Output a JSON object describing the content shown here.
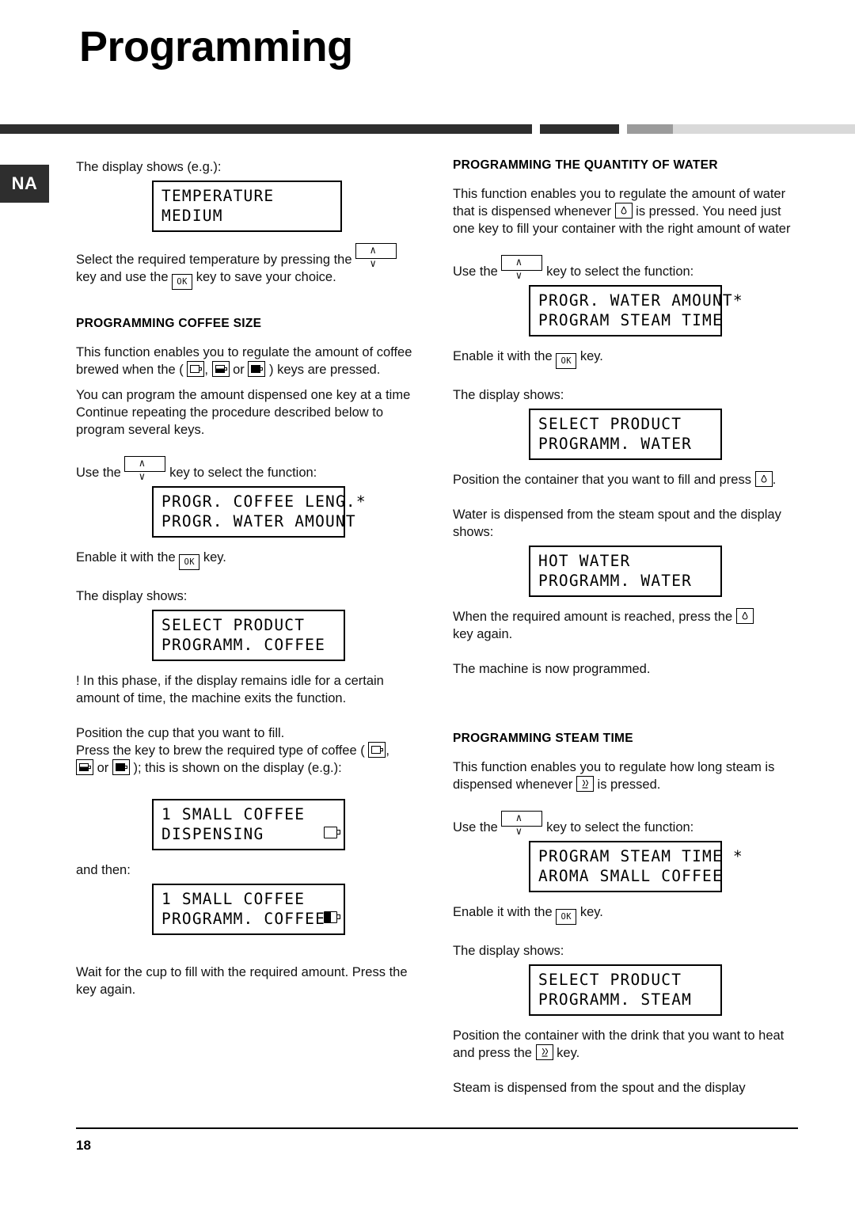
{
  "header": {
    "title": "Programming",
    "side_tab": "NA"
  },
  "footer": {
    "page_number": "18"
  },
  "left_column": {
    "intro_text": "The display shows (e.g.):",
    "lcd_temperature": {
      "line1": "TEMPERATURE",
      "line2": "MEDIUM"
    },
    "select_temp_part1": "Select the required temperature by pressing the",
    "select_temp_part2": "key and use the",
    "select_temp_part3": "key to save your choice.",
    "coffee_size_heading": "PROGRAMMING COFFEE SIZE",
    "coffee_size_p1_a": "This function enables you to regulate the amount of coffee brewed when the (",
    "coffee_size_p1_b": ",",
    "coffee_size_p1_c": "or",
    "coffee_size_p1_d": ") keys are pressed.",
    "coffee_size_p2": "You can program the amount dispensed one key at a time Continue repeating the procedure described below to program several keys.",
    "use_key_label": "Use the",
    "use_key_suffix": "key to select the function:",
    "lcd_progr_coffee": {
      "line1": "PROGR. COFFEE LENG.",
      "line1_mark": "*",
      "line2": "PROGR. WATER AMOUNT"
    },
    "enable_prefix": "Enable it with the",
    "enable_suffix": "key.",
    "display_shows": "The display shows:",
    "lcd_select_product_coffee": {
      "line1": "SELECT PRODUCT",
      "line2": "PROGRAMM. COFFEE"
    },
    "idle_warning": "! In this phase, if the display remains idle for a certain amount of time, the machine exits the function.",
    "position_cup": "Position the cup that you want to fill.",
    "press_key_a": "Press the key to brew the required type of coffee (",
    "press_key_b": ",",
    "press_key_c": "or",
    "press_key_d": "); this is shown on the display (e.g.):",
    "lcd_dispensing": {
      "line1": "1 SMALL COFFEE",
      "line2": "DISPENSING"
    },
    "and_then": "and then:",
    "lcd_programm_coffee": {
      "line1": "1 SMALL COFFEE",
      "line2": "PROGRAMM. COFFEE"
    },
    "wait_text": "Wait for the cup to fill with the required amount. Press the key again."
  },
  "right_column": {
    "water_heading": "PROGRAMMING THE QUANTITY OF WATER",
    "water_p1_a": "This function enables you to regulate the amount of water that is dispensed whenever",
    "water_p1_b": "is pressed. You need just one key to fill your container with the right amount of water",
    "use_key_label": "Use the",
    "use_key_suffix": "key to select the function:",
    "lcd_progr_water": {
      "line1": "PROGR. WATER AMOUNT",
      "line1_mark": "*",
      "line2": "PROGRAM STEAM TIME"
    },
    "enable_prefix": "Enable it with the",
    "enable_suffix": "key.",
    "display_shows": "The display shows:",
    "lcd_select_product_water": {
      "line1": "SELECT PRODUCT",
      "line2": "PROGRAMM. WATER"
    },
    "position_container_a": "Position the container that you want to fill and press",
    "position_container_b": ".",
    "water_dispensed": "Water is dispensed from the steam spout and the display shows:",
    "lcd_hot_water": {
      "line1": "HOT WATER",
      "line2": "PROGRAMM. WATER"
    },
    "when_reached_a": "When the required amount is reached, press the",
    "when_reached_b": "key again.",
    "machine_programmed": "The machine is now programmed.",
    "steam_heading": "PROGRAMMING STEAM TIME",
    "steam_p1_a": "This function enables you to regulate how long steam is dispensed whenever",
    "steam_p1_b": "is pressed.",
    "lcd_program_steam": {
      "line1": "PROGRAM STEAM TIME",
      "line1_mark": "*",
      "line2": "AROMA SMALL COFFEE"
    },
    "lcd_select_product_steam": {
      "line1": "SELECT PRODUCT",
      "line2": "PROGRAMM. STEAM"
    },
    "position_drink_a": "Position the container with the drink that you want to heat and press the",
    "position_drink_b": "key.",
    "steam_dispensed": "Steam is dispensed from the spout and the display"
  },
  "icons": {
    "up_down_key": "∧    ∨",
    "ok_key": "OK",
    "water_drop": "water-drop-icon",
    "steam": "steam-icon",
    "cup_small": "small-cup-icon",
    "cup_medium": "medium-cup-icon",
    "cup_large": "large-cup-icon"
  }
}
